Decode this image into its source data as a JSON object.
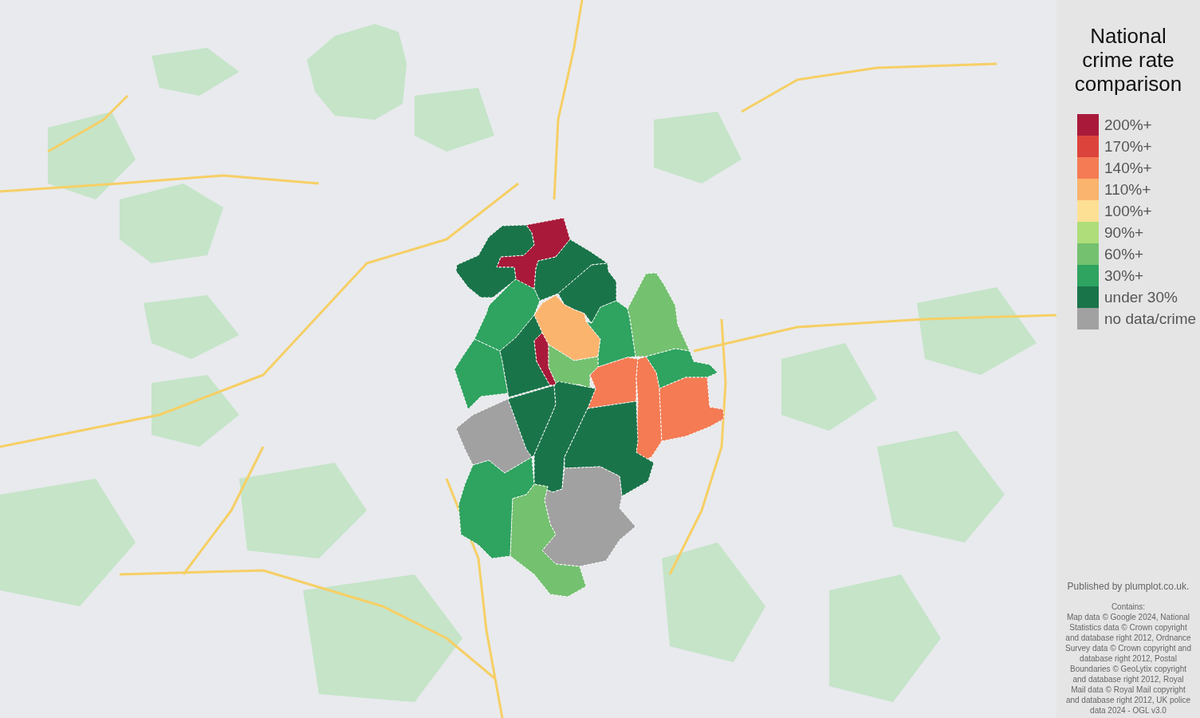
{
  "map": {
    "regions": [
      {
        "color": "#a91a3a"
      },
      {
        "color": "#1a744a"
      },
      {
        "color": "#1a744a"
      },
      {
        "color": "#1a744a"
      },
      {
        "color": "#74c170"
      },
      {
        "color": "#2fa360"
      },
      {
        "color": "#fbb46e"
      },
      {
        "color": "#2fa360"
      },
      {
        "color": "#2fa360"
      },
      {
        "color": "#1a744a"
      },
      {
        "color": "#a91a3a"
      },
      {
        "color": "#74c170"
      },
      {
        "color": "#2fa360"
      },
      {
        "color": "#f47b54"
      },
      {
        "color": "#f47b54"
      },
      {
        "color": "#f47b54"
      },
      {
        "color": "#a1a1a1"
      },
      {
        "color": "#1a744a"
      },
      {
        "color": "#1a744a"
      },
      {
        "color": "#1a744a"
      },
      {
        "color": "#2fa360"
      },
      {
        "color": "#a1a1a1"
      },
      {
        "color": "#74c170"
      }
    ]
  },
  "legend": {
    "title": "National crime rate comparison",
    "items": [
      {
        "label": "200%+",
        "color": "#a91a3a"
      },
      {
        "label": "170%+",
        "color": "#dc433b"
      },
      {
        "label": "140%+",
        "color": "#f47b54"
      },
      {
        "label": "110%+",
        "color": "#fbb46e"
      },
      {
        "label": "100%+",
        "color": "#fde093"
      },
      {
        "label": "90%+",
        "color": "#aedd7a"
      },
      {
        "label": "60%+",
        "color": "#74c170"
      },
      {
        "label": "30%+",
        "color": "#2fa360"
      },
      {
        "label": "under 30%",
        "color": "#1a744a"
      },
      {
        "label": "no data/crime",
        "color": "#a1a1a1"
      }
    ]
  },
  "credits": {
    "published": "Published by plumplot.co.uk.",
    "contains_label": "Contains:",
    "attribution": "Map data © Google 2024, National Statistics data © Crown copyright and database right 2012, Ordnance Survey data © Crown copyright and database right 2012, Postal Boundaries © GeoLytix copyright and database right 2012, Royal Mail data © Royal Mail copyright and database right 2012, UK police data 2024 - OGL v3.0"
  }
}
